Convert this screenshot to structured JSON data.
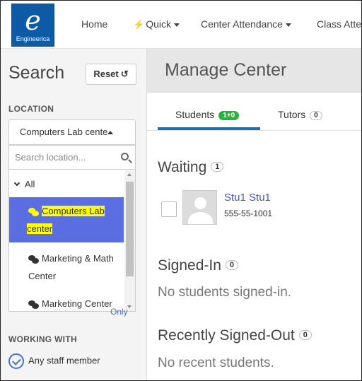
{
  "logo": {
    "mark": "e",
    "text": "Engineerica"
  },
  "nav": {
    "home": "Home",
    "quick": "Quick",
    "center_attendance": "Center Attendance",
    "class_attendance": "Class Atte"
  },
  "sidebar": {
    "search_title": "Search",
    "reset_label": "Reset",
    "location_label": "LOCATION",
    "location_selected": "Computers Lab cente",
    "search_placeholder": "Search location...",
    "all_label": "All",
    "options": [
      {
        "line1": "Computers Lab",
        "line2": "center"
      },
      {
        "line1": "Marketing & Math",
        "line2": "Center"
      },
      {
        "line1": "Marketing Center",
        "line2": ""
      }
    ],
    "only_label": "Only",
    "working_with_label": "WORKING WITH",
    "staff_label": "Any staff member"
  },
  "main": {
    "title": "Manage Center",
    "tabs": [
      {
        "label": "Students",
        "badge": "1+0"
      },
      {
        "label": "Tutors",
        "badge": "0"
      }
    ],
    "waiting": {
      "heading": "Waiting",
      "count": "1"
    },
    "student": {
      "name": "Stu1 Stu1",
      "id": "555-55-1001"
    },
    "signed_in": {
      "heading": "Signed-In",
      "count": "0",
      "empty": "No students signed-in."
    },
    "recent": {
      "heading": "Recently Signed-Out",
      "count": "0",
      "empty": "No recent students."
    }
  },
  "colors": {
    "brand": "#0d5aa7",
    "selection": "#5b6ee1",
    "highlight": "#ffff00",
    "badge_green": "#2ab23c",
    "link": "#4a56b8"
  }
}
